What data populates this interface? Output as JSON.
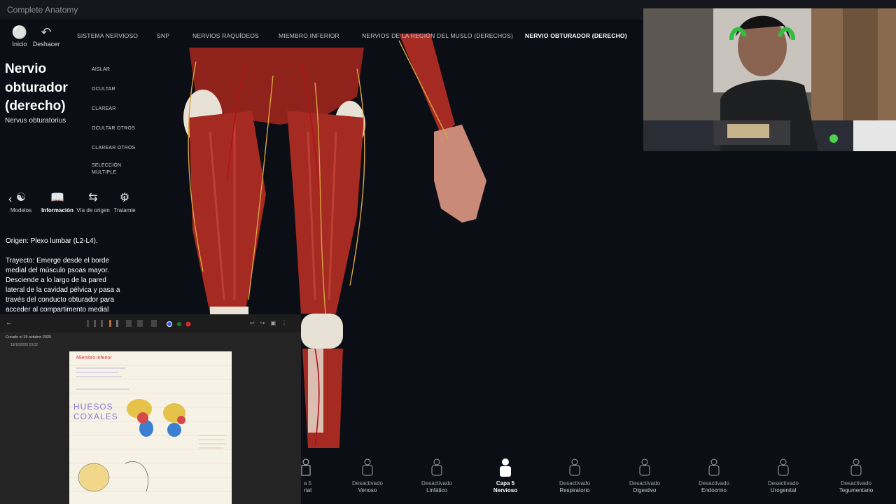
{
  "window": {
    "title": "Complete Anatomy"
  },
  "nav": {
    "home_label": "Inicio",
    "undo_label": "Deshacer",
    "breadcrumbs": [
      "SISTEMA NERVIOSO",
      "SNP",
      "NERVIOS RAQUÍDEOS",
      "MIEMBRO INFERIOR",
      "NERVIOS DE LA REGIÓN DEL MUSLO (DERECHOS)",
      "NERVIO OBTURADOR (DERECHO)"
    ]
  },
  "panel": {
    "title_lines": [
      "Nervio",
      "obturador",
      "(derecho)"
    ],
    "latin": "Nervus obturatorius",
    "actions": [
      "AISLAR",
      "OCULTAR",
      "CLAREAR",
      "OCULTAR OTROS",
      "CLAREAR OTROS",
      "SELECCIÓN",
      "MÚLTIPLE"
    ],
    "tabs": [
      "Modelos",
      "Información",
      "Vía de origen",
      "Tratamie"
    ],
    "origin": "Origen: Plexo lumbar (L2-L4).",
    "trajectory_lines": [
      "Trayecto: Emerge desde el borde",
      "medial del músculo psoas mayor.",
      "Desciende a lo largo de la pared",
      "lateral de la cavidad pélvica y pasa a",
      "través del conducto obturador para",
      "acceder al compartimento medial"
    ]
  },
  "notes": {
    "created": "Creado el 19 octubre 2025",
    "timestamp": "19/10/2025 23:02",
    "page_heading": "Miembro inferior",
    "sketch_title": "HUESOS COXALES"
  },
  "systems": [
    {
      "state": "a 5",
      "name": "rial",
      "active": false
    },
    {
      "state": "Desactivado",
      "name": "Venoso",
      "active": false
    },
    {
      "state": "Desactivado",
      "name": "Linfático",
      "active": false
    },
    {
      "state": "Capa 5",
      "name": "Nervioso",
      "active": true
    },
    {
      "state": "Desactivado",
      "name": "Respiratorio",
      "active": false
    },
    {
      "state": "Desactivado",
      "name": "Digestivo",
      "active": false
    },
    {
      "state": "Desactivado",
      "name": "Endocrino",
      "active": false
    },
    {
      "state": "Desactivado",
      "name": "Urogenital",
      "active": false
    },
    {
      "state": "Desactivado",
      "name": "Tegumentario",
      "active": false
    }
  ],
  "colors": {
    "muscle": "#a42a22",
    "bone": "#e8e2d6",
    "nerve": "#d9a441",
    "vessel": "#b3121a"
  }
}
